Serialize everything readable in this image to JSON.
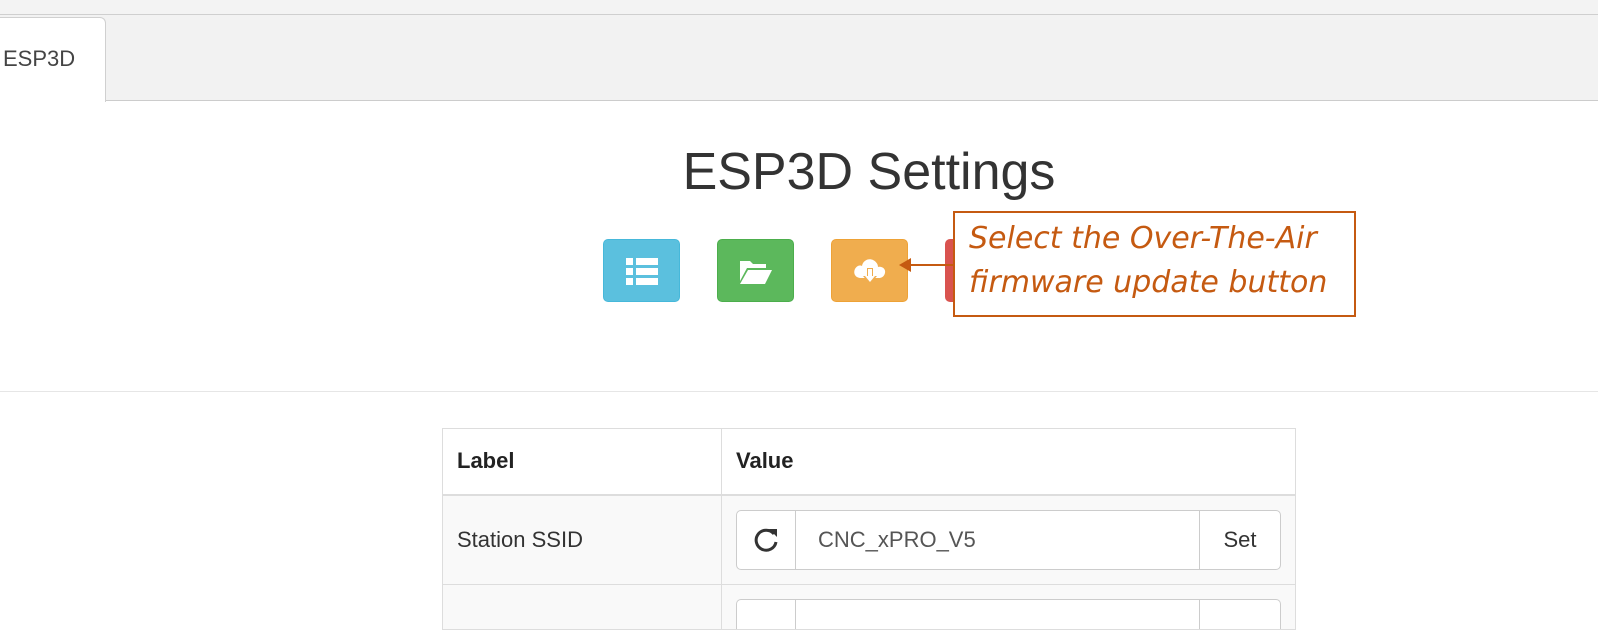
{
  "browser": {
    "tab_label": "ESP3D"
  },
  "page": {
    "title": "ESP3D Settings"
  },
  "toolbar": {
    "buttons": [
      {
        "icon": "list-icon",
        "color": "#5bc0de"
      },
      {
        "icon": "folder-open-icon",
        "color": "#5cb85c"
      },
      {
        "icon": "cloud-download-icon",
        "color": "#f0ad4e"
      },
      {
        "icon": "unknown",
        "color": "#d9534f"
      }
    ]
  },
  "callout": {
    "text": "Select the Over-The-Air\nfirmware update button",
    "color": "#c55a11"
  },
  "table": {
    "headers": [
      "Label",
      "Value"
    ],
    "rows": [
      {
        "label": "Station SSID",
        "value": "CNC_xPRO_V5",
        "set_label": "Set"
      }
    ]
  }
}
